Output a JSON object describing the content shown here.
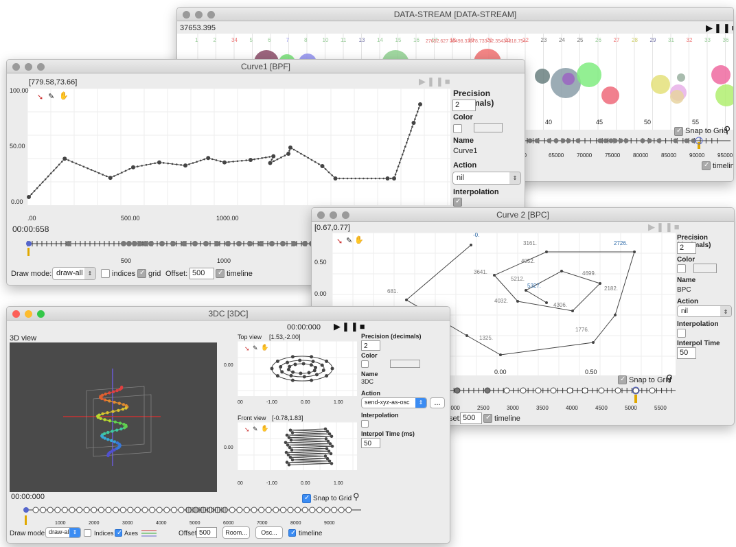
{
  "datastream": {
    "title": "DATA-STREAM [DATA-STREAM]",
    "cursor": "37653.395",
    "ids": [
      "1",
      "2",
      "34",
      "5",
      "6",
      "7",
      "8",
      "10",
      "11",
      "13",
      "14",
      "15",
      "16",
      "17",
      "18",
      "19",
      "20",
      "21",
      "22",
      "23",
      "24",
      "25",
      "26",
      "27",
      "28",
      "29",
      "31",
      "32",
      "33",
      "36"
    ],
    "floatlabels": [
      "27652.627",
      "30498.339",
      "78.733",
      "32.354",
      "34818.754"
    ],
    "x_ticks": [
      "40",
      "45",
      "50",
      "55"
    ],
    "time_ticks": [
      "60000",
      "65000",
      "70000",
      "75000",
      "80000",
      "85000",
      "90000",
      "95000"
    ],
    "snap": "Snap to Grid",
    "timeline": "timeline"
  },
  "bpf": {
    "title": "Curve1 [BPF]",
    "cursor": "[779.58,73.66]",
    "y_ticks": [
      "100.00",
      "50.00",
      "0.00"
    ],
    "x_ticks": [
      ".00",
      "500.00",
      "1000.00"
    ],
    "time": "00:00:658",
    "time_ticks": [
      "500",
      "1000"
    ],
    "precision_label": "Precision (decimals)",
    "precision": "2",
    "color_label": "Color",
    "name_label": "Name",
    "name": "Curve1",
    "action_label": "Action",
    "action": "nil",
    "interp_label": "Interpolation",
    "drawmode_label": "Draw mode:",
    "drawmode": "draw-all",
    "indices": "indices",
    "grid": "grid",
    "offset_label": "Offset:",
    "offset": "500",
    "timeline": "timeline"
  },
  "bpc": {
    "title": "Curve 2 [BPC]",
    "cursor": "[0.67,0.77]",
    "y_ticks": [
      "0.50",
      "0.00"
    ],
    "x_ticks": [
      "0.00",
      "0.50"
    ],
    "point_labels": [
      "-0.",
      "3161.",
      "2726.",
      "681.",
      "3641.",
      "4952.",
      "5212.",
      "5327.",
      "4699.",
      "4032.",
      "4306.",
      "2182.",
      "1776.",
      "1325."
    ],
    "time_ticks": [
      "2000",
      "2500",
      "3000",
      "3500",
      "4000",
      "4500",
      "5000",
      "5500"
    ],
    "precision_label": "Precision (decimals)",
    "precision": "2",
    "color_label": "Color",
    "name_label": "Name",
    "name": "BPC",
    "action_label": "Action",
    "action": "nil",
    "interp_label": "Interpolation",
    "interp_time_label": "Interpol Time (ms)",
    "interp_time": "50",
    "snap": "Snap to Grid",
    "offset_label": "set:",
    "offset": "500",
    "timeline": "timeline"
  },
  "c3dc": {
    "title": "3DC [3DC]",
    "time_top": "00:00:000",
    "view3d": "3D view",
    "top_view": "Top view",
    "top_cursor": "[1.53,-2.00]",
    "front_view": "Front view",
    "front_cursor": "[-0.78,1.83]",
    "y_tick": "0.00",
    "x_ticks": [
      "-1.00",
      "0.00",
      "1.00"
    ],
    "x_first": "00",
    "time_bottom": "00:00:000",
    "time_ticks": [
      "1000",
      "2000",
      "3000",
      "4000",
      "5000",
      "6000",
      "7000",
      "8000",
      "9000"
    ],
    "precision_label": "Precision (decimals)",
    "precision": "2",
    "color_label": "Color",
    "name_label": "Name",
    "name": "3DC",
    "action_label": "Action",
    "action": "send-xyz-as-osc",
    "more": "...",
    "interp_label": "Interpolation",
    "interp_time_label": "Interpol Time (ms)",
    "interp_time": "50",
    "snap": "Snap to Grid",
    "drawmode_label": "Draw mode:",
    "drawmode": "draw-all",
    "indices": "Indices",
    "axes": "Axes",
    "offset_label": "Offset:",
    "offset": "500",
    "room": "Room...",
    "osc": "Osc...",
    "timeline": "timeline"
  },
  "colors": {
    "accent": "#3b8cf3",
    "playhead": "#e0a800",
    "curve": "#444444"
  }
}
